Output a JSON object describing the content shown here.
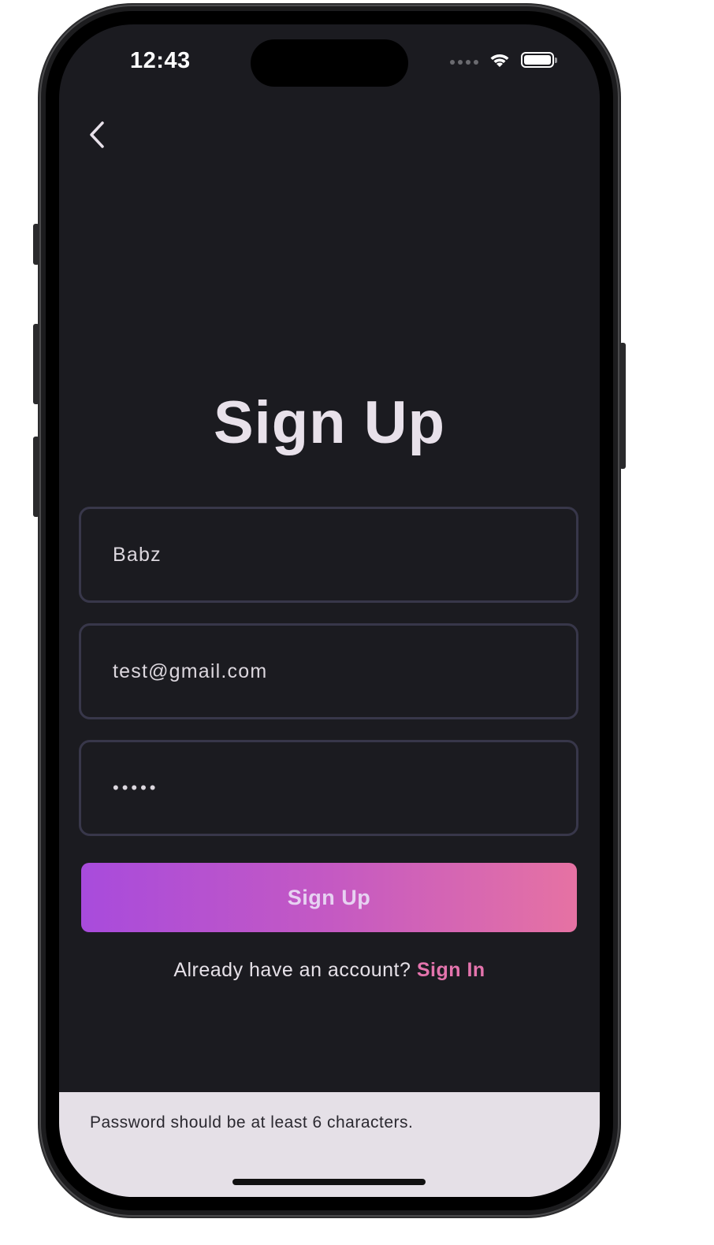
{
  "status_bar": {
    "time": "12:43"
  },
  "navigation": {
    "back_icon": "chevron-left-icon"
  },
  "page": {
    "title": "Sign Up"
  },
  "form": {
    "name_value": "Babz",
    "email_value": "test@gmail.com",
    "password_value": "•••••",
    "submit_label": "Sign Up"
  },
  "footer": {
    "prompt": "Already have an account?",
    "link_label": "Sign In"
  },
  "snackbar": {
    "message": "Password should be at least 6 characters."
  },
  "colors": {
    "background": "#1b1b20",
    "field_border": "#38374a",
    "gradient_start": "#a84bdc",
    "gradient_end": "#e672a3",
    "link": "#e474ad",
    "snackbar_bg": "#e5e0e7"
  }
}
